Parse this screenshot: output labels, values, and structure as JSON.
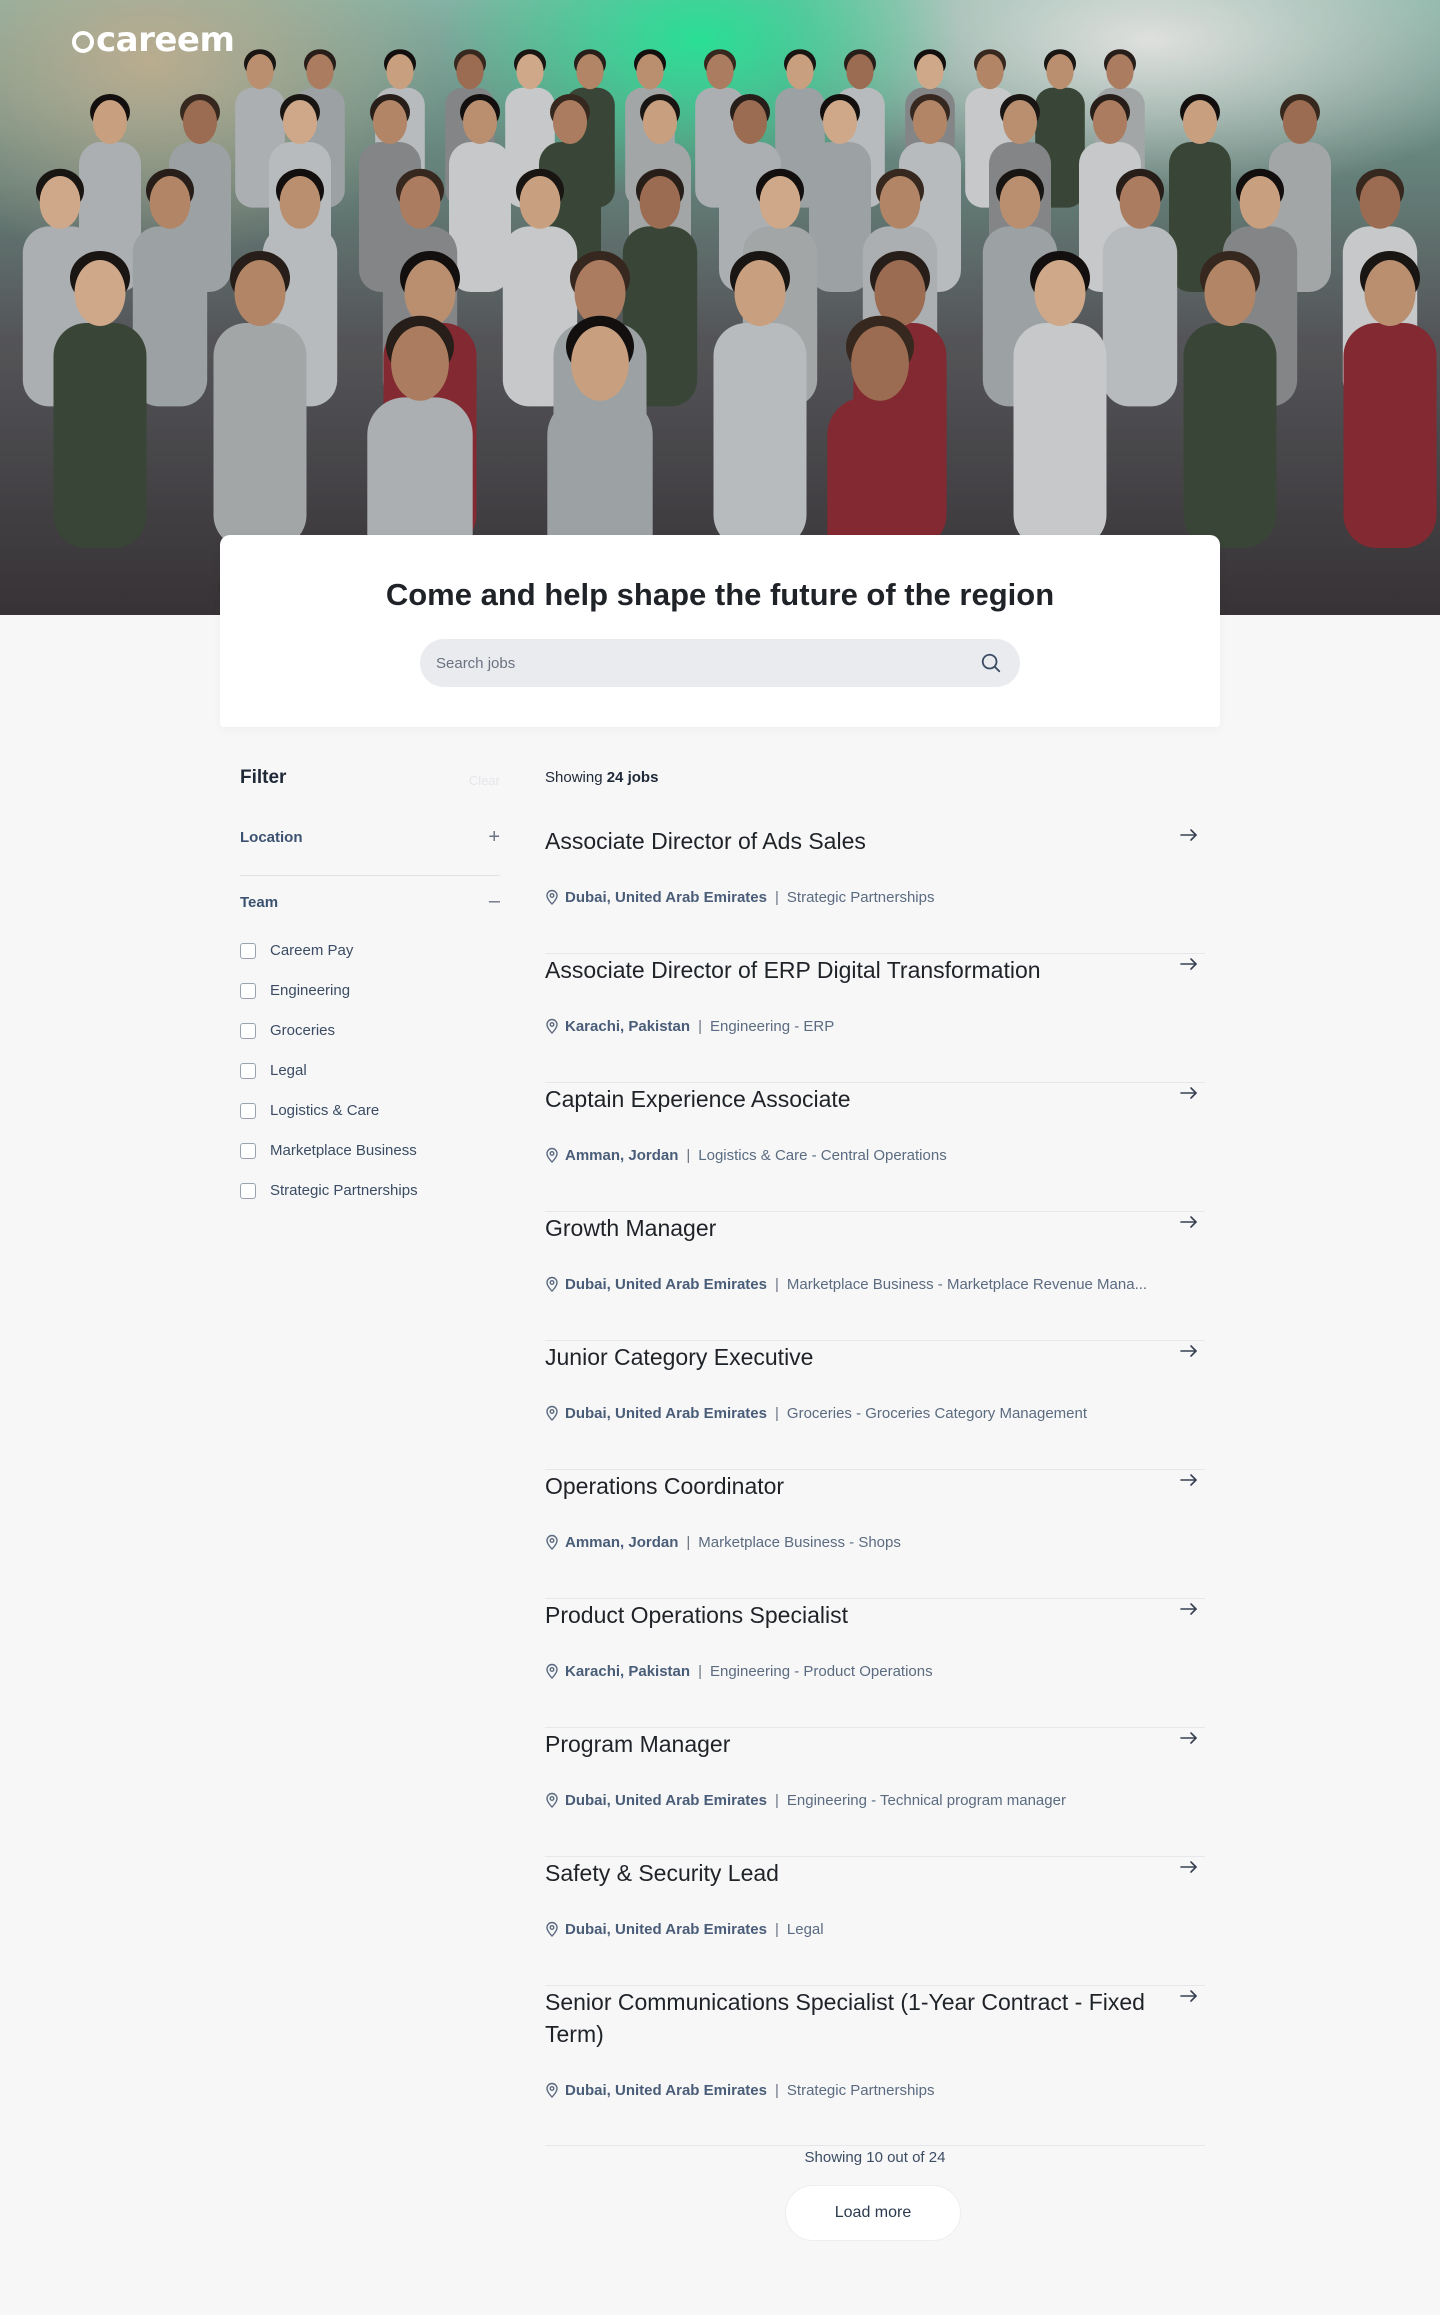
{
  "brand": {
    "logo_text": "careem"
  },
  "hero": {
    "title": "Come and help shape the future of the region",
    "search_placeholder": "Search jobs"
  },
  "filter": {
    "title": "Filter",
    "clear_label": "Clear",
    "location_label": "Location",
    "location_toggle": "+",
    "team_label": "Team",
    "team_toggle": "–",
    "teams": [
      {
        "label": "Careem Pay",
        "checked": false
      },
      {
        "label": "Engineering",
        "checked": false
      },
      {
        "label": "Groceries",
        "checked": false
      },
      {
        "label": "Legal",
        "checked": false
      },
      {
        "label": "Logistics & Care",
        "checked": false
      },
      {
        "label": "Marketplace Business",
        "checked": false
      },
      {
        "label": "Strategic Partnerships",
        "checked": false
      }
    ]
  },
  "jobs": {
    "showing_prefix": "Showing",
    "showing_count": "24 jobs",
    "items": [
      {
        "title": "Associate Director of Ads Sales",
        "location": "Dubai, United Arab Emirates",
        "team": "Strategic Partnerships"
      },
      {
        "title": "Associate Director of ERP Digital Transformation",
        "location": "Karachi, Pakistan",
        "team": "Engineering - ERP"
      },
      {
        "title": "Captain Experience Associate",
        "location": "Amman, Jordan",
        "team": "Logistics & Care - Central Operations"
      },
      {
        "title": "Growth Manager",
        "location": "Dubai, United Arab Emirates",
        "team": "Marketplace Business - Marketplace Revenue Mana..."
      },
      {
        "title": "Junior Category Executive",
        "location": "Dubai, United Arab Emirates",
        "team": "Groceries - Groceries Category Management"
      },
      {
        "title": "Operations Coordinator",
        "location": "Amman, Jordan",
        "team": "Marketplace Business - Shops"
      },
      {
        "title": "Product Operations Specialist",
        "location": "Karachi, Pakistan",
        "team": "Engineering - Product Operations"
      },
      {
        "title": "Program Manager",
        "location": "Dubai, United Arab Emirates",
        "team": "Engineering - Technical program manager"
      },
      {
        "title": "Safety & Security Lead",
        "location": "Dubai, United Arab Emirates",
        "team": "Legal"
      },
      {
        "title": "Senior Communications Specialist (1-Year Contract - Fixed Term)",
        "location": "Dubai, United Arab Emirates",
        "team": "Strategic Partnerships"
      }
    ],
    "separator": "|",
    "pager_text": "Showing 10 out of 24",
    "load_more_label": "Load more"
  },
  "colors": {
    "page_bg": "#f7f7f8",
    "heading": "#1f2328",
    "meta_text": "#5b6b80",
    "accent_green": "#2cf0a0"
  },
  "icons": {
    "search": "search-icon",
    "location": "map-pin-icon",
    "arrow": "arrow-right-icon"
  }
}
